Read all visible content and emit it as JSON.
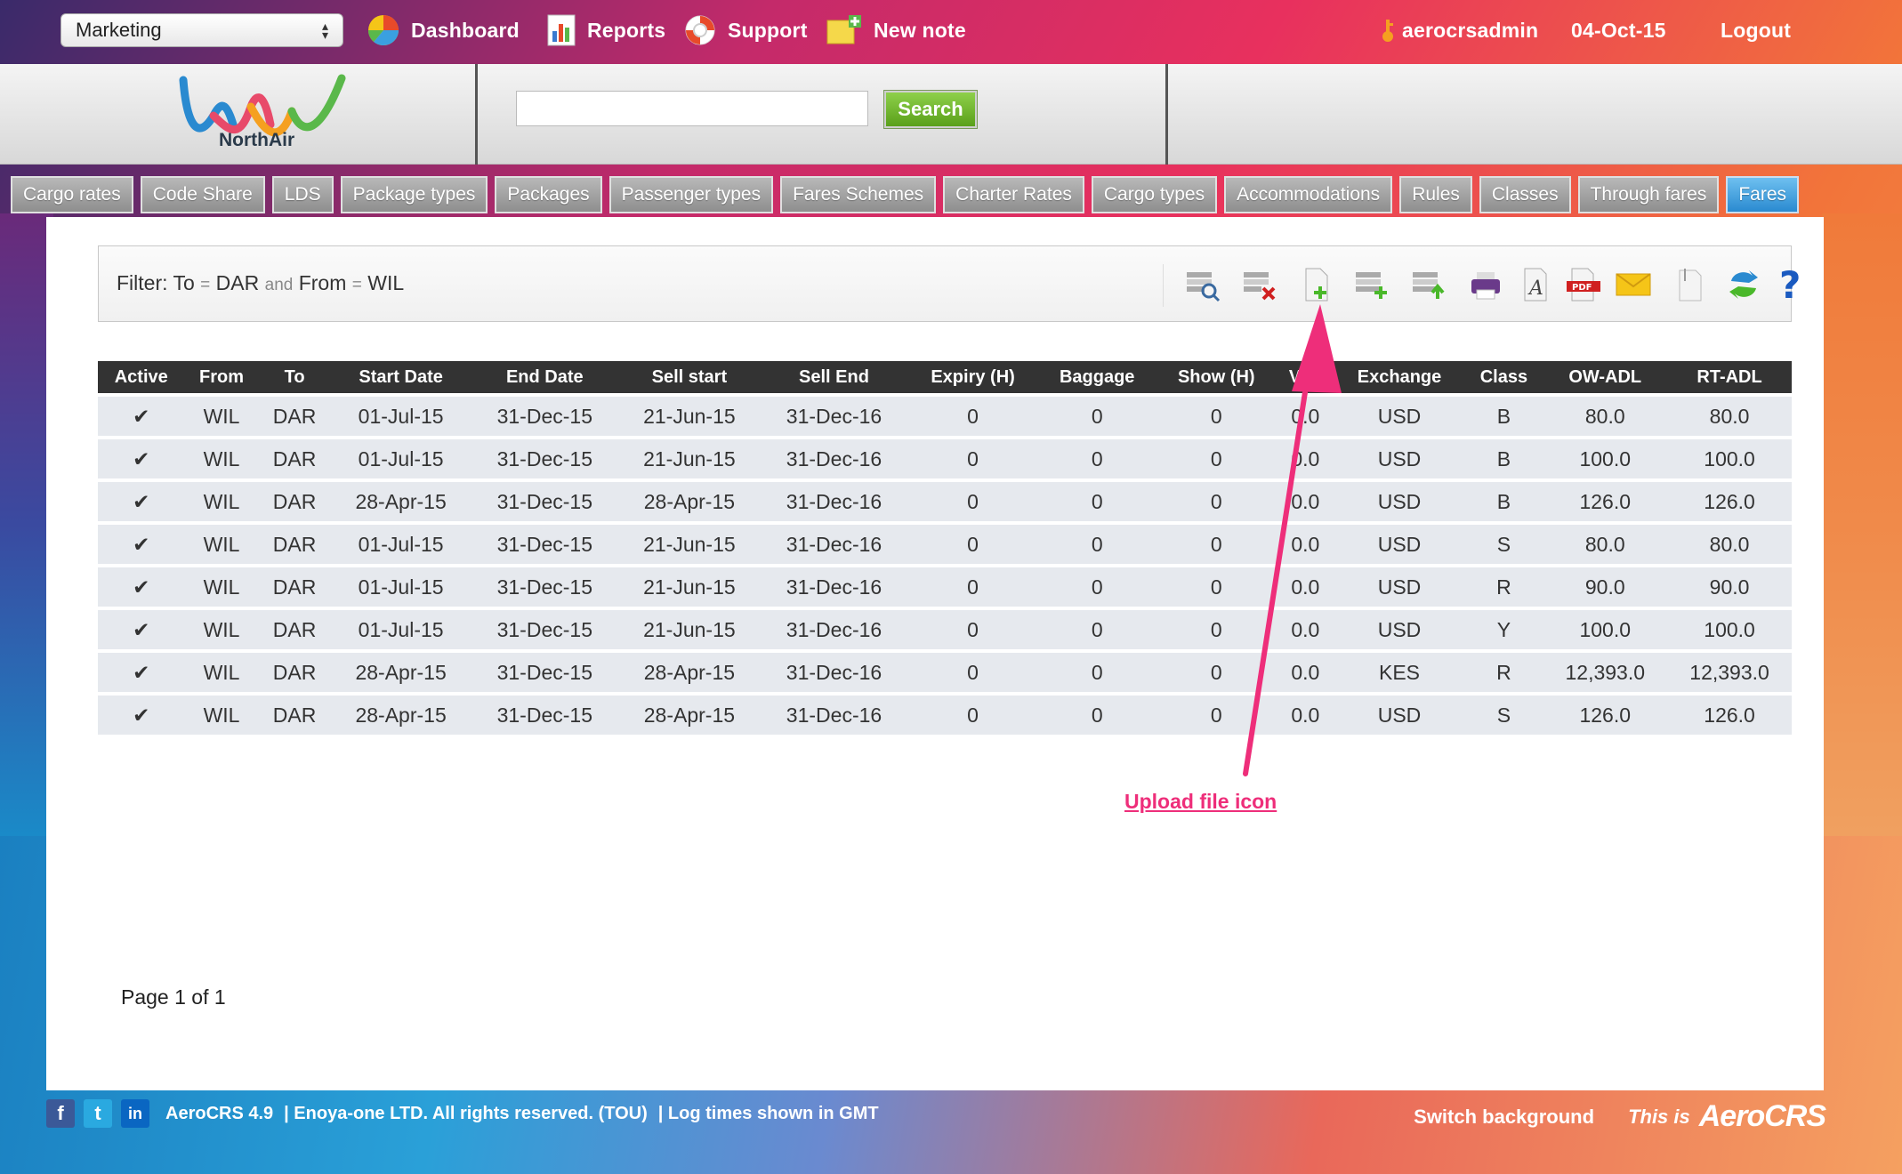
{
  "topbar": {
    "module": "Marketing",
    "dashboard": "Dashboard",
    "reports": "Reports",
    "support": "Support",
    "new_note": "New note",
    "user": "aerocrsadmin",
    "date": "04-Oct-15",
    "logout": "Logout"
  },
  "header": {
    "logo_text": "NorthAir",
    "search_value": "",
    "search_button": "Search"
  },
  "tabs": [
    "Cargo rates",
    "Code Share",
    "LDS",
    "Package types",
    "Packages",
    "Passenger types",
    "Fares Schemes",
    "Charter Rates",
    "Cargo types",
    "Accommodations",
    "Rules",
    "Classes",
    "Through fares",
    "Fares"
  ],
  "active_tab": "Fares",
  "filter": {
    "label": "Filter:",
    "f1_field": "To",
    "eq": "=",
    "f1_value": "DAR",
    "and": "and",
    "f2_field": "From",
    "f2_value": "WIL"
  },
  "toolbar_icons": [
    "search-records-icon",
    "delete-icon",
    "new-document-icon",
    "upload-file-icon",
    "export-icon",
    "print-icon",
    "font-icon",
    "pdf-icon",
    "email-icon",
    "attachment-icon",
    "refresh-icon",
    "help-icon"
  ],
  "table": {
    "columns": [
      "Active",
      "From",
      "To",
      "Start Date",
      "End Date",
      "Sell start",
      "Sell End",
      "Expiry (H)",
      "Baggage",
      "Show (H)",
      "VAT",
      "Exchange",
      "Class",
      "OW-ADL",
      "RT-ADL"
    ],
    "rows": [
      [
        "✔",
        "WIL",
        "DAR",
        "01-Jul-15",
        "31-Dec-15",
        "21-Jun-15",
        "31-Dec-16",
        "0",
        "0",
        "0",
        "0.0",
        "USD",
        "B",
        "80.0",
        "80.0"
      ],
      [
        "✔",
        "WIL",
        "DAR",
        "01-Jul-15",
        "31-Dec-15",
        "21-Jun-15",
        "31-Dec-16",
        "0",
        "0",
        "0",
        "0.0",
        "USD",
        "B",
        "100.0",
        "100.0"
      ],
      [
        "✔",
        "WIL",
        "DAR",
        "28-Apr-15",
        "31-Dec-15",
        "28-Apr-15",
        "31-Dec-16",
        "0",
        "0",
        "0",
        "0.0",
        "USD",
        "B",
        "126.0",
        "126.0"
      ],
      [
        "✔",
        "WIL",
        "DAR",
        "01-Jul-15",
        "31-Dec-15",
        "21-Jun-15",
        "31-Dec-16",
        "0",
        "0",
        "0",
        "0.0",
        "USD",
        "S",
        "80.0",
        "80.0"
      ],
      [
        "✔",
        "WIL",
        "DAR",
        "01-Jul-15",
        "31-Dec-15",
        "21-Jun-15",
        "31-Dec-16",
        "0",
        "0",
        "0",
        "0.0",
        "USD",
        "R",
        "90.0",
        "90.0"
      ],
      [
        "✔",
        "WIL",
        "DAR",
        "01-Jul-15",
        "31-Dec-15",
        "21-Jun-15",
        "31-Dec-16",
        "0",
        "0",
        "0",
        "0.0",
        "USD",
        "Y",
        "100.0",
        "100.0"
      ],
      [
        "✔",
        "WIL",
        "DAR",
        "28-Apr-15",
        "31-Dec-15",
        "28-Apr-15",
        "31-Dec-16",
        "0",
        "0",
        "0",
        "0.0",
        "KES",
        "R",
        "12,393.0",
        "12,393.0"
      ],
      [
        "✔",
        "WIL",
        "DAR",
        "28-Apr-15",
        "31-Dec-15",
        "28-Apr-15",
        "31-Dec-16",
        "0",
        "0",
        "0",
        "0.0",
        "USD",
        "S",
        "126.0",
        "126.0"
      ]
    ]
  },
  "page_info": "Page 1 of 1",
  "annotation": "Upload file icon",
  "footer": {
    "version": "AeroCRS 4.9",
    "copyright": "| Enoya-one LTD. All rights reserved. (TOU)",
    "log_times": "| Log times shown in GMT",
    "switch_background": "Switch background",
    "this_is": "This is",
    "brand": "AeroCRS"
  },
  "colors": {
    "accent_green": "#6ab82a",
    "active_tab": "#3a9ae0",
    "annotation": "#ee2e7a",
    "table_header": "#333333",
    "row_bg": "#e6e9ee"
  }
}
